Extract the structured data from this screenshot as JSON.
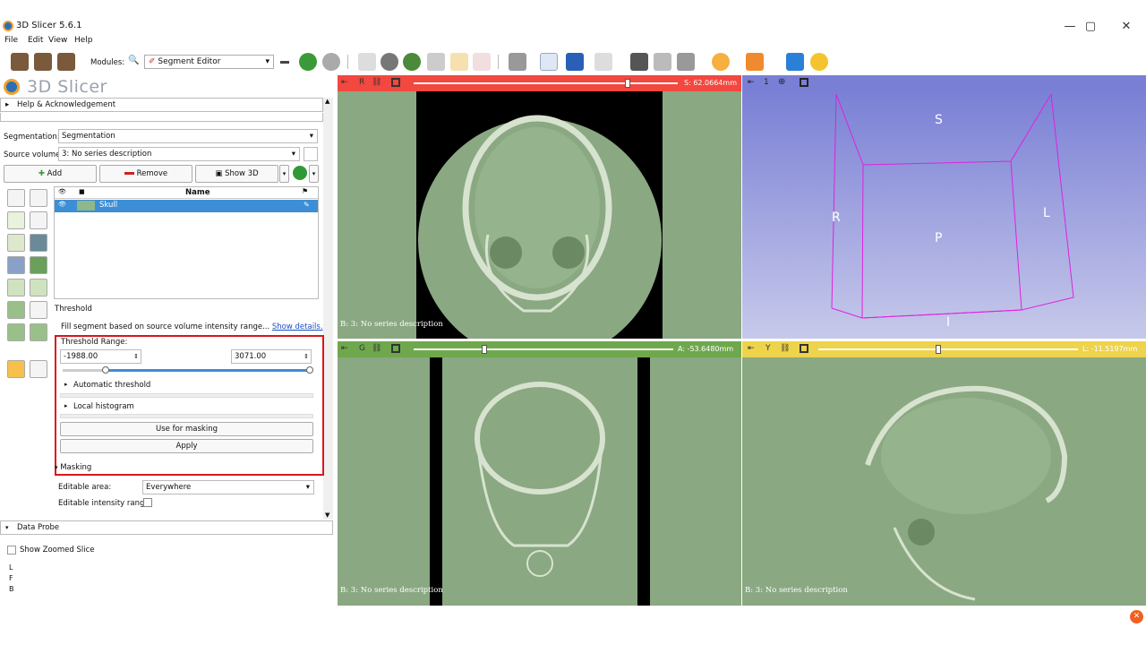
{
  "window": {
    "title": "3D Slicer 5.6.1",
    "controls": [
      "—",
      "▢",
      "✕"
    ]
  },
  "menu": {
    "file": "File",
    "edit": "Edit",
    "view": "View",
    "help": "Help"
  },
  "toolbar": {
    "modules_label": "Modules:",
    "module_selected": "Segment Editor"
  },
  "left": {
    "brand": "3D Slicer",
    "help_section": "Help & Acknowledgement",
    "segmentation_label": "Segmentation:",
    "segmentation_value": "Segmentation",
    "source_label": "Source volume:",
    "source_value": "3: No series description",
    "add": "Add",
    "remove": "Remove",
    "show3d": "Show 3D",
    "table_header_name": "Name",
    "segment_name": "Skull",
    "threshold_title": "Threshold",
    "threshold_desc": "Fill segment based on source volume intensity range...",
    "show_details": "Show details.",
    "threshold_range_label": "Threshold Range:",
    "range_min": "-1988.00",
    "range_max": "3071.00",
    "auto_threshold": "Automatic threshold",
    "local_histogram": "Local histogram",
    "use_for_masking": "Use for masking",
    "apply": "Apply",
    "masking": "Masking",
    "editable_area_label": "Editable area:",
    "editable_area_value": "Everywhere",
    "editable_intensity_label": "Editable intensity range:",
    "data_probe": "Data Probe",
    "show_zoomed": "Show Zoomed Slice",
    "probe_lines": [
      "L",
      "F",
      "B"
    ]
  },
  "views": {
    "red": {
      "letter": "R",
      "offset": "S: 62.0664mm",
      "desc": "B: 3: No series description",
      "color": "#f2483f",
      "slider": 0.67
    },
    "threeD": {
      "letter": "1",
      "labels": {
        "s": "S",
        "r": "R",
        "l": "L",
        "p": "P",
        "i": "I"
      },
      "color": "#7a7fd6"
    },
    "green": {
      "letter": "G",
      "offset": "A: -53.6480mm",
      "desc": "B: 3: No series description",
      "color": "#6fa84c",
      "slider": 0.27
    },
    "yellow": {
      "letter": "Y",
      "offset": "L: -11.5197mm",
      "desc": "B: 3: No series description",
      "color": "#eed34c",
      "slider": 0.46
    }
  },
  "colors": {
    "accent_red": "#d9161c",
    "selection": "#3c8fd6",
    "view_bg": "#8aa882"
  }
}
